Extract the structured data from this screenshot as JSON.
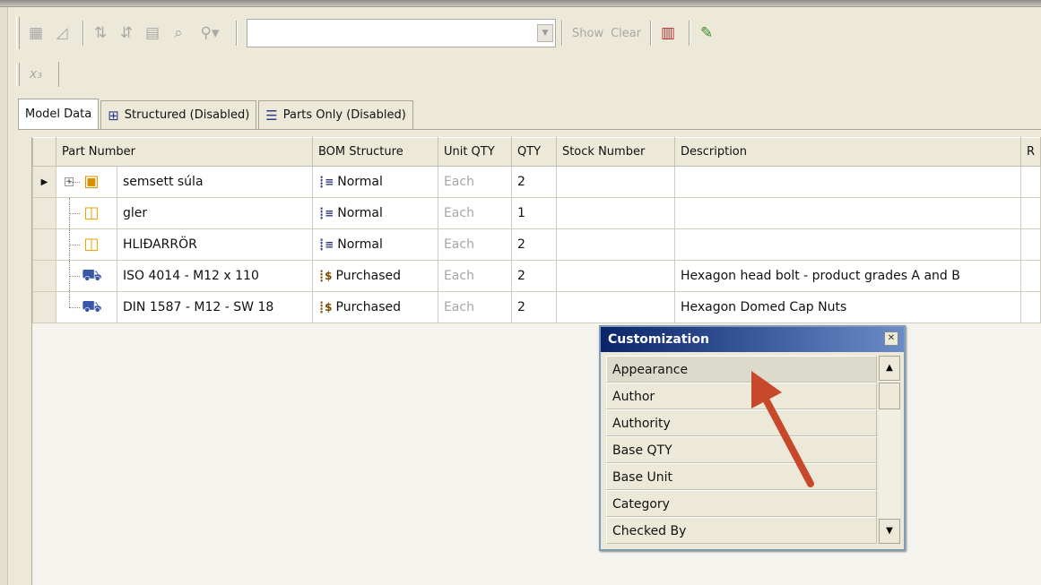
{
  "toolbar": {
    "show_label": "Show",
    "clear_label": "Clear",
    "filter_value": ""
  },
  "tabs": [
    {
      "label": "Model Data"
    },
    {
      "label": "Structured (Disabled)"
    },
    {
      "label": "Parts Only (Disabled)"
    }
  ],
  "grid": {
    "columns": [
      "Part Number",
      "BOM Structure",
      "Unit QTY",
      "QTY",
      "Stock Number",
      "Description",
      "R"
    ],
    "rows": [
      {
        "part_number": "semsett súla",
        "bom": "Normal",
        "unit_qty": "Each",
        "qty": "2",
        "stock": "",
        "description": "",
        "icon": "assembly-icon"
      },
      {
        "part_number": "gler",
        "bom": "Normal",
        "unit_qty": "Each",
        "qty": "1",
        "stock": "",
        "description": "",
        "icon": "part-icon"
      },
      {
        "part_number": "HLIÐARRÖR",
        "bom": "Normal",
        "unit_qty": "Each",
        "qty": "2",
        "stock": "",
        "description": "",
        "icon": "part-icon"
      },
      {
        "part_number": "ISO 4014 - M12 x 110",
        "bom": "Purchased",
        "unit_qty": "Each",
        "qty": "2",
        "stock": "",
        "description": "Hexagon head bolt - product grades A and B",
        "icon": "purchased-part-icon"
      },
      {
        "part_number": "DIN 1587 - M12 - SW 18",
        "bom": "Purchased",
        "unit_qty": "Each",
        "qty": "2",
        "stock": "",
        "description": "Hexagon Domed Cap Nuts",
        "icon": "purchased-part-icon"
      }
    ]
  },
  "customization": {
    "title": "Customization",
    "items": [
      "Appearance",
      "Author",
      "Authority",
      "Base QTY",
      "Base Unit",
      "Category",
      "Checked By"
    ]
  },
  "colors": {
    "window_bg": "#ece9d8",
    "title_bar_start": "#0a246a",
    "title_bar_end": "#6a8cc8",
    "annotation_arrow": "#c8482c"
  }
}
